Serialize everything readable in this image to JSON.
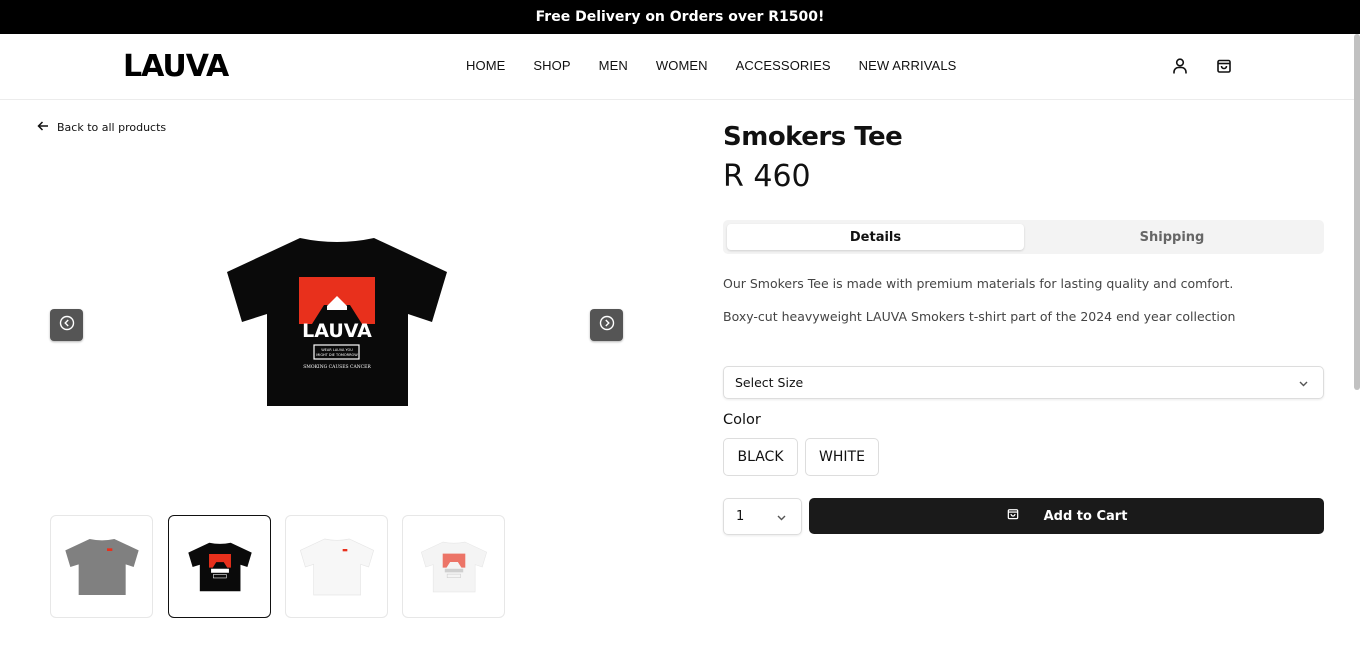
{
  "announcement": "Free Delivery on Orders over R1500!",
  "brand": {
    "logo_text": "LAUVA"
  },
  "nav": {
    "items": [
      {
        "label": "HOME"
      },
      {
        "label": "SHOP"
      },
      {
        "label": "MEN"
      },
      {
        "label": "WOMEN"
      },
      {
        "label": "ACCESSORIES"
      },
      {
        "label": "NEW ARRIVALS"
      }
    ],
    "icons": [
      "user-icon",
      "shopping-bag-icon"
    ]
  },
  "back_link": {
    "label": "Back to all products",
    "icon": "arrow-left-icon"
  },
  "gallery": {
    "prev_icon": "chevron-left-circle-icon",
    "next_icon": "chevron-right-circle-icon",
    "main_print": {
      "logo": "LAUVA",
      "box_text_1": "WEAR LAUVA YOU",
      "box_text_2": "MIGHT DIE TOMORROW",
      "footer_text": "SMOKING CAUSES CANCER"
    },
    "thumbnails": [
      {
        "color": "grey",
        "active": false
      },
      {
        "color": "black",
        "active": true
      },
      {
        "color": "white",
        "active": false
      },
      {
        "color": "white-print",
        "active": false
      }
    ]
  },
  "product": {
    "title": "Smokers Tee",
    "price": "R 460",
    "tabs": [
      {
        "label": "Details",
        "active": true
      },
      {
        "label": "Shipping",
        "active": false
      }
    ],
    "description": [
      "Our Smokers Tee is made with premium materials for lasting quality and comfort.",
      "Boxy-cut heavyweight LAUVA Smokers t-shirt part of the 2024 end year collection"
    ],
    "size_select": {
      "placeholder": "Select Size"
    },
    "color_label": "Color",
    "colors": [
      "BLACK",
      "WHITE"
    ],
    "quantity": "1",
    "add_to_cart": "Add to Cart"
  },
  "colors": {
    "accent_red": "#e8301c",
    "button_dark": "#1a1a1a",
    "arrow_bg": "#555555"
  }
}
